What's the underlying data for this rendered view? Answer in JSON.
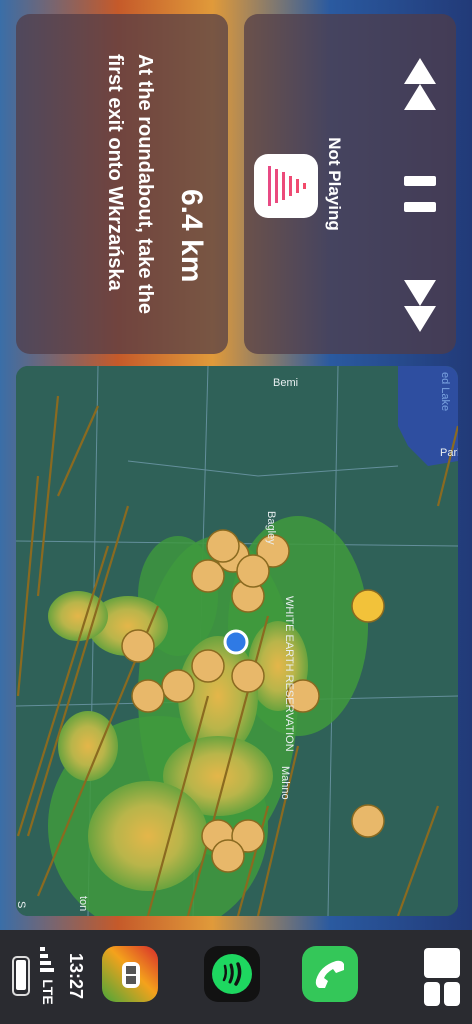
{
  "navigation": {
    "distance": "6.4 km",
    "instruction": "At the roundabout, take the first exit onto Wkrzańska"
  },
  "now_playing": {
    "status": "Not Playing"
  },
  "map": {
    "labels": {
      "lake": "ed Lake",
      "bemidji": "Bemi",
      "bagley": "Bagley",
      "reservation": "WHITE EARTH RESERVATION",
      "mahnomen": "Mahno",
      "park_rapids": "Park Rapids",
      "crookston": "ton",
      "edge": "S"
    }
  },
  "status_bar": {
    "time": "13:27",
    "network": "LTE"
  },
  "colors": {
    "accent_radar_red": "#d62b2b",
    "spotify_green": "#1ed760",
    "phone_green": "#34c759",
    "storm_yellow": "#f4c842"
  }
}
